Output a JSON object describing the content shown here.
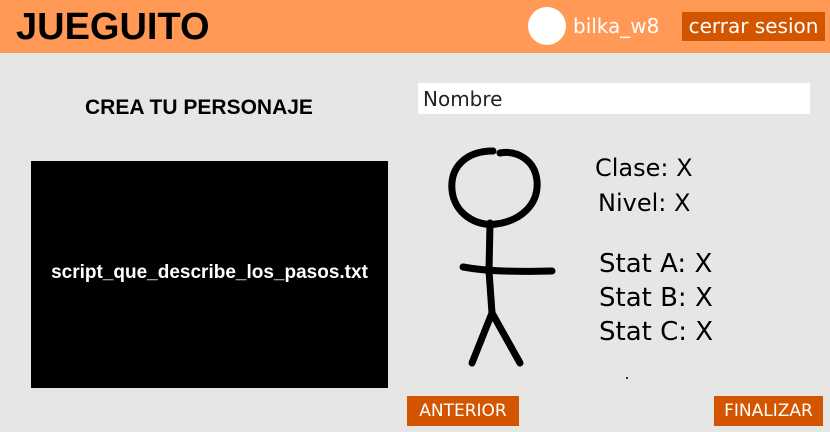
{
  "header": {
    "app_title": "JUEGUITO",
    "username": "bilka_w8",
    "logout_label": "cerrar sesion",
    "bar_color": "#ff9955",
    "button_color": "#d45500"
  },
  "main": {
    "section_title": "CREA TU PERSONAJE",
    "script_box_text": "script_que_describe_los_pasos.txt",
    "name_input": {
      "placeholder": "Nombre",
      "value": ""
    },
    "character_icon": "stick-figure",
    "info": {
      "clase": "Clase: X",
      "nivel": "Nivel: X"
    },
    "stats": [
      {
        "label": "Stat A: X"
      },
      {
        "label": "Stat B: X"
      },
      {
        "label": "Stat C: X"
      }
    ]
  },
  "footer": {
    "back_label": "ANTERIOR",
    "finish_label": "FINALIZAR"
  }
}
